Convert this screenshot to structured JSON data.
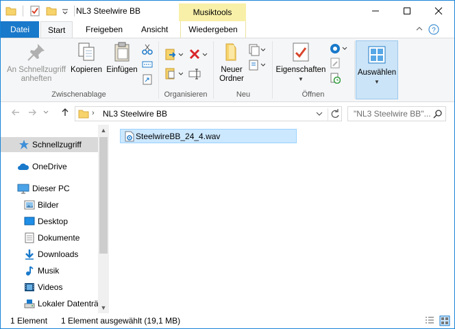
{
  "window": {
    "title": "NL3 Steelwire BB",
    "context_tab_group": "Musiktools"
  },
  "tabs": {
    "datei": "Datei",
    "start": "Start",
    "freigeben": "Freigeben",
    "ansicht": "Ansicht",
    "wiedergeben": "Wiedergeben"
  },
  "ribbon": {
    "clipboard": {
      "pin_label_1": "An Schnellzugriff",
      "pin_label_2": "anheften",
      "copy": "Kopieren",
      "paste": "Einfügen",
      "group": "Zwischenablage"
    },
    "organize": {
      "group": "Organisieren"
    },
    "new": {
      "folder_1": "Neuer",
      "folder_2": "Ordner",
      "group": "Neu"
    },
    "open": {
      "properties": "Eigenschaften",
      "group": "Öffnen"
    },
    "select": {
      "label": "Auswählen"
    }
  },
  "address": {
    "path": "NL3 Steelwire BB",
    "search_placeholder": "\"NL3 Steelwire BB\"..."
  },
  "nav": {
    "items": [
      {
        "label": "Schnellzugriff",
        "icon": "star-icon"
      },
      {
        "label": "OneDrive",
        "icon": "cloud-icon"
      },
      {
        "label": "Dieser PC",
        "icon": "computer-icon"
      },
      {
        "label": "Bilder",
        "icon": "pictures-icon"
      },
      {
        "label": "Desktop",
        "icon": "desktop-icon"
      },
      {
        "label": "Dokumente",
        "icon": "documents-icon"
      },
      {
        "label": "Downloads",
        "icon": "download-icon"
      },
      {
        "label": "Musik",
        "icon": "music-icon"
      },
      {
        "label": "Videos",
        "icon": "video-icon"
      },
      {
        "label": "Lokaler Datenträ",
        "icon": "drive-icon"
      }
    ]
  },
  "files": [
    {
      "name": "SteelwireBB_24_4.wav",
      "selected": true
    }
  ],
  "status": {
    "count": "1 Element",
    "selection": "1 Element ausgewählt (19,1 MB)"
  },
  "colors": {
    "accent": "#1979ca",
    "context_tab": "#f8f0a8",
    "selection": "#cce8ff"
  }
}
